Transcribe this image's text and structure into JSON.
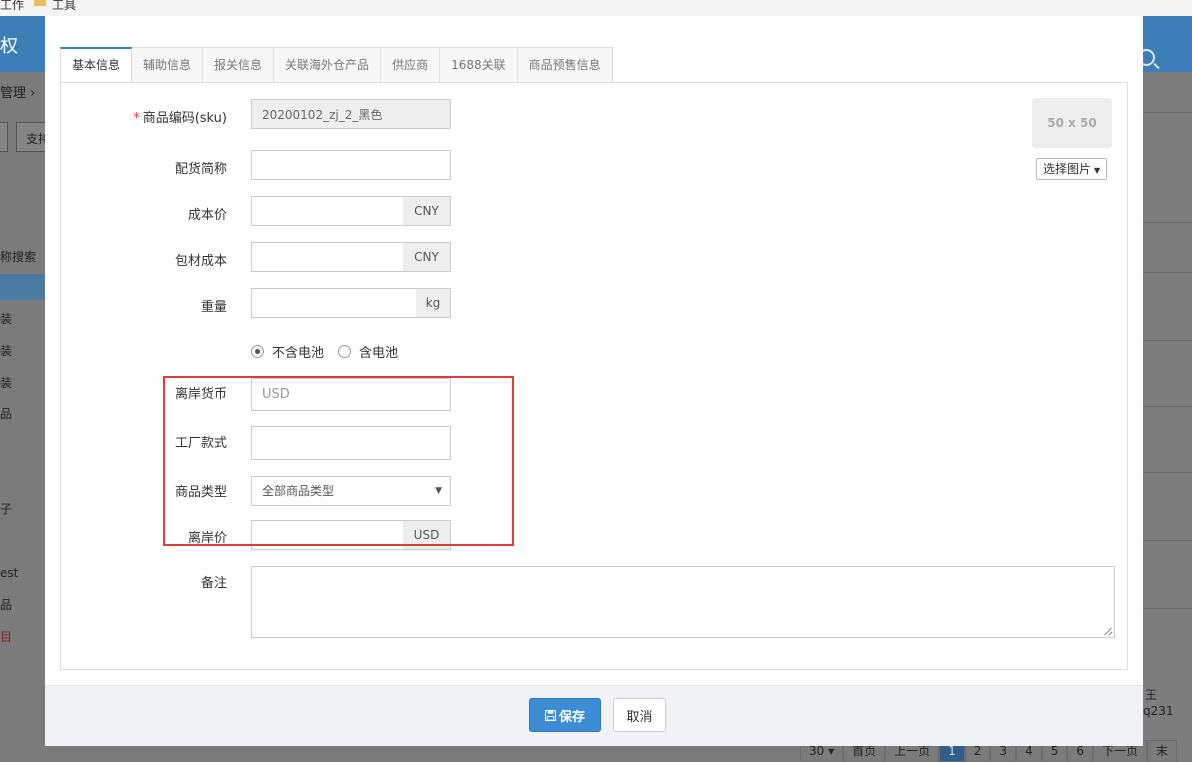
{
  "background": {
    "topbar_items": [
      "工作",
      "工具"
    ],
    "header_title": "权",
    "sidebar_texts": [
      "管理 ›",
      "支持",
      "称搜索",
      "装",
      "装",
      "装",
      "品",
      "子",
      "est",
      "品",
      "目"
    ],
    "right_texts": [
      "王",
      "q231"
    ],
    "pager": [
      "30 ▾",
      "首页",
      "上一页",
      "1",
      "2",
      "3",
      "4",
      "5",
      "6",
      "下一页",
      "末"
    ]
  },
  "modal": {
    "tabs": [
      {
        "label": "基本信息",
        "active": true
      },
      {
        "label": "辅助信息",
        "active": false
      },
      {
        "label": "报关信息",
        "active": false
      },
      {
        "label": "关联海外仓产品",
        "active": false
      },
      {
        "label": "供应商",
        "active": false
      },
      {
        "label": "1688关联",
        "active": false
      },
      {
        "label": "商品预售信息",
        "active": false
      }
    ],
    "form": {
      "sku": {
        "required_mark": "*",
        "label": "商品编码(sku)",
        "value": "20200102_zj_2_黑色"
      },
      "alias": {
        "label": "配货简称",
        "value": ""
      },
      "cost": {
        "label": "成本价",
        "value": "",
        "unit": "CNY"
      },
      "packing_cost": {
        "label": "包材成本",
        "value": "",
        "unit": "CNY"
      },
      "weight": {
        "label": "重量",
        "value": "",
        "unit": "kg"
      },
      "battery": {
        "options": [
          "不含电池",
          "含电池"
        ],
        "selected": "不含电池"
      },
      "fob_currency": {
        "label": "离岸货币",
        "placeholder": "USD"
      },
      "factory_style": {
        "label": "工厂款式",
        "value": ""
      },
      "product_type": {
        "label": "商品类型",
        "selected": "全部商品类型"
      },
      "fob_price": {
        "label": "离岸价",
        "value": "",
        "unit": "USD"
      },
      "remark": {
        "label": "备注",
        "value": ""
      }
    },
    "image": {
      "placeholder": "50 x 50",
      "select_label": "选择图片"
    },
    "footer": {
      "save_label": "保存",
      "cancel_label": "取消"
    }
  },
  "colors": {
    "accent": "#3c8dd6",
    "highlight": "#e03c3c",
    "tab_active_border": "#3c7fb7"
  }
}
